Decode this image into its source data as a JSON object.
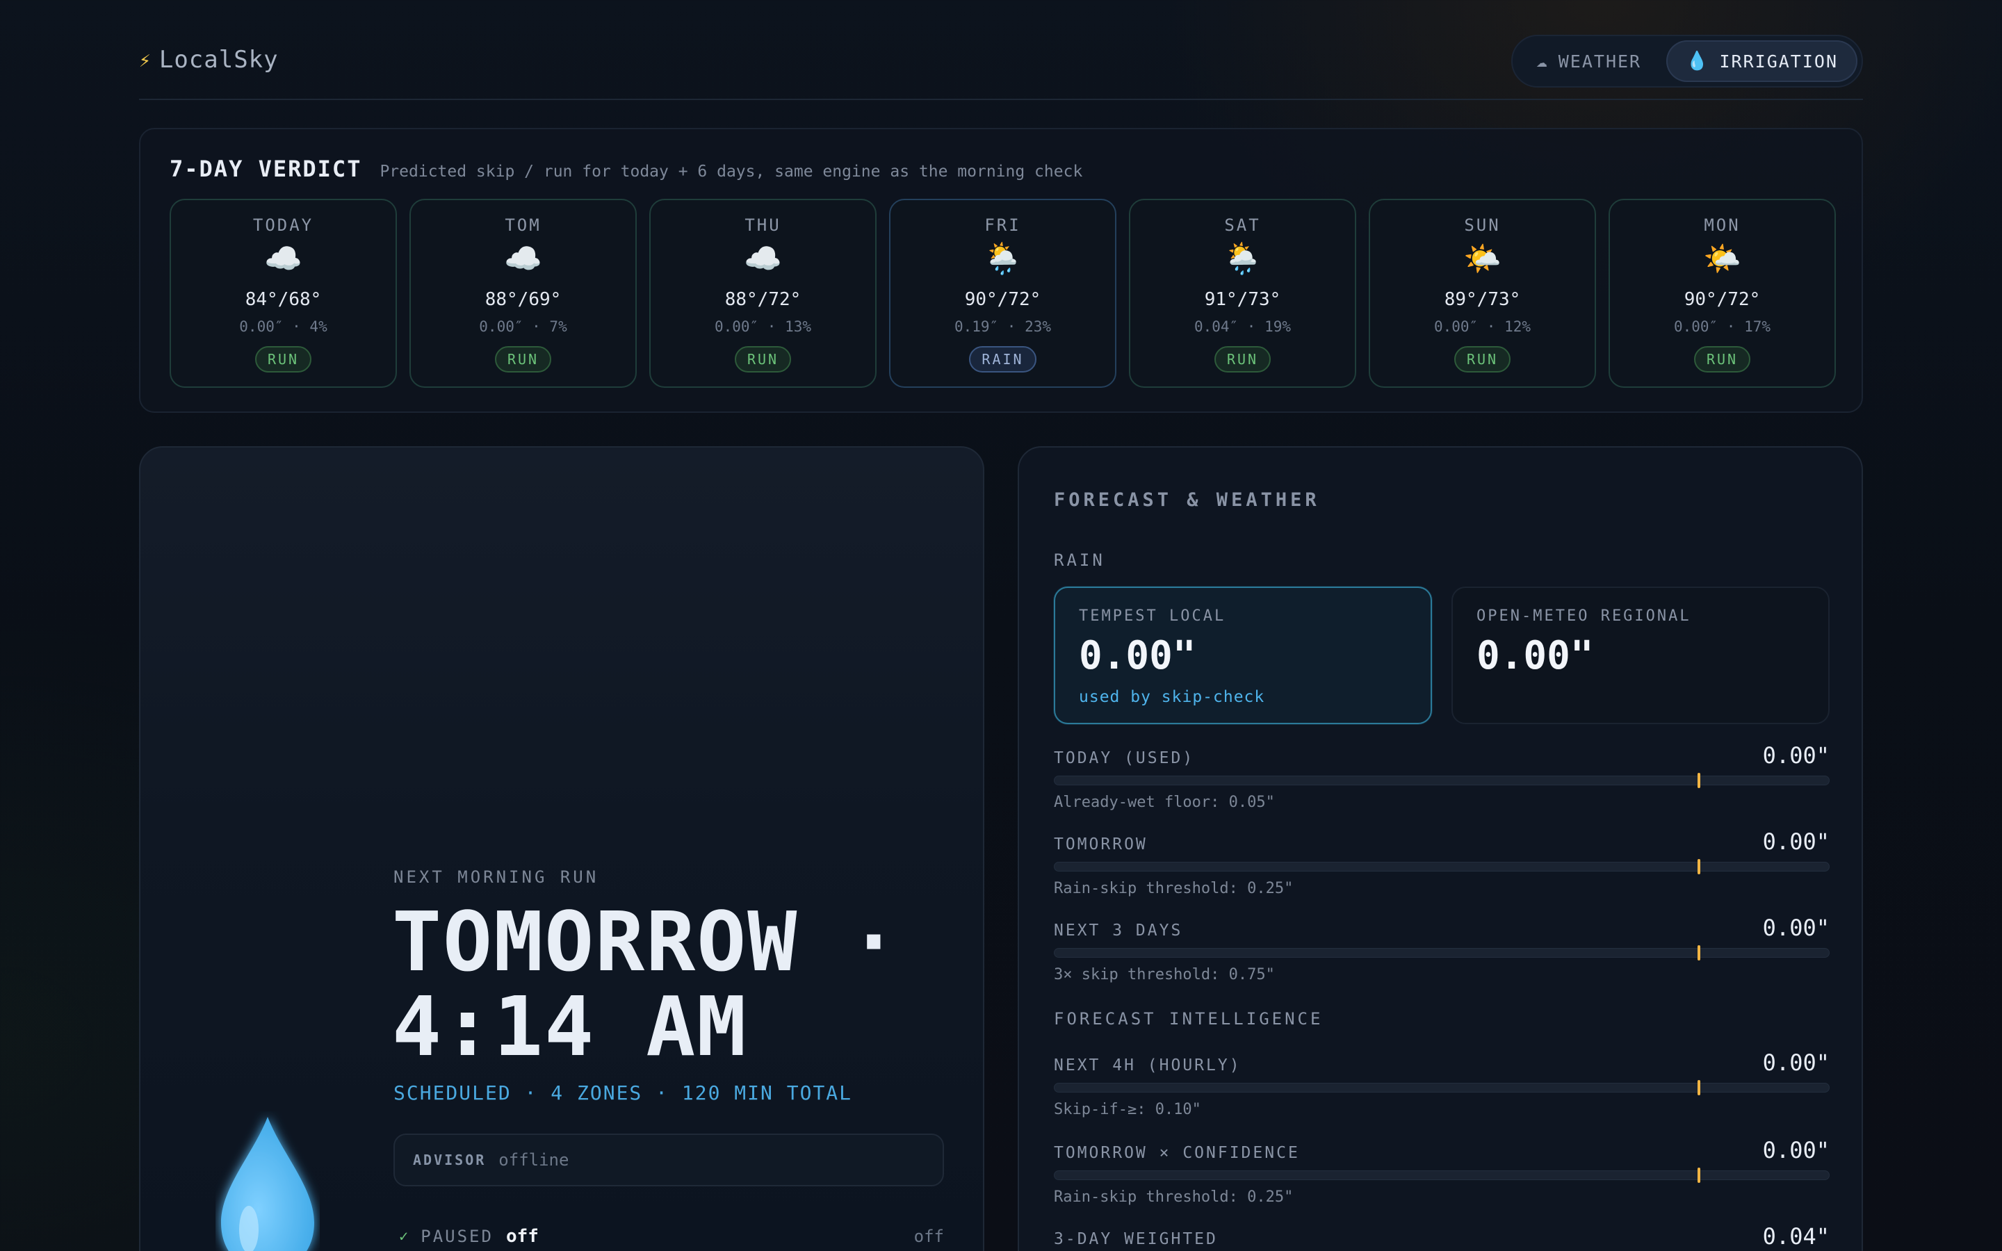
{
  "brand": {
    "icon": "lightning-icon",
    "name": "LocalSky"
  },
  "modes": [
    {
      "icon": "cloud-icon",
      "label": "WEATHER",
      "active": false
    },
    {
      "icon": "droplet-icon",
      "label": "IRRIGATION",
      "active": true
    }
  ],
  "verdict": {
    "title": "7-DAY VERDICT",
    "subtitle": "Predicted skip / run for today + 6 days, same engine as the morning check",
    "days": [
      {
        "label": "TODAY",
        "icon": "☁️",
        "temp": "84°/68°",
        "meta": "0.00″ · 4%",
        "status": "RUN"
      },
      {
        "label": "TOM",
        "icon": "☁️",
        "temp": "88°/69°",
        "meta": "0.00″ · 7%",
        "status": "RUN"
      },
      {
        "label": "THU",
        "icon": "☁️",
        "temp": "88°/72°",
        "meta": "0.00″ · 13%",
        "status": "RUN"
      },
      {
        "label": "FRI",
        "icon": "🌦️",
        "temp": "90°/72°",
        "meta": "0.19″ · 23%",
        "status": "RAIN"
      },
      {
        "label": "SAT",
        "icon": "🌦️",
        "temp": "91°/73°",
        "meta": "0.04″ · 19%",
        "status": "RUN"
      },
      {
        "label": "SUN",
        "icon": "🌤️",
        "temp": "89°/73°",
        "meta": "0.00″ · 12%",
        "status": "RUN"
      },
      {
        "label": "MON",
        "icon": "🌤️",
        "temp": "90°/72°",
        "meta": "0.00″ · 17%",
        "status": "RUN"
      }
    ]
  },
  "next_run": {
    "label": "NEXT MORNING RUN",
    "time": "TOMORROW · 4:14 AM",
    "schedule": "SCHEDULED · 4 ZONES · 120 MIN TOTAL",
    "advisor_label": "ADVISOR",
    "advisor_value": "offline",
    "paused_label": "PAUSED",
    "paused_value": "off",
    "paused_right": "off"
  },
  "forecast": {
    "title": "FORECAST & WEATHER",
    "rain_section": "RAIN",
    "local": {
      "label": "TEMPEST LOCAL",
      "value": "0.00\"",
      "note": "used by skip-check"
    },
    "regional": {
      "label": "OPEN-METEO REGIONAL",
      "value": "0.00\""
    },
    "intel_section": "FORECAST INTELLIGENCE",
    "metrics": [
      {
        "label": "TODAY (USED)",
        "value": "0.00\"",
        "note": "Already-wet floor: 0.05\"",
        "level": 0.83
      },
      {
        "label": "TOMORROW",
        "value": "0.00\"",
        "note": "Rain-skip threshold: 0.25\"",
        "level": 0.83
      },
      {
        "label": "NEXT 3 DAYS",
        "value": "0.00\"",
        "note": "3× skip threshold: 0.75\"",
        "level": 0.83
      },
      {
        "label": "NEXT 4H (HOURLY)",
        "value": "0.00\"",
        "note": "Skip-if-≥: 0.10\"",
        "level": 0.83
      },
      {
        "label": "TOMORROW × CONFIDENCE",
        "value": "0.00\"",
        "note": "Rain-skip threshold: 0.25\"",
        "level": 0.83
      },
      {
        "label": "3-DAY WEIGHTED",
        "value": "0.04\"",
        "note": "",
        "level": 0.83
      }
    ]
  },
  "colors": {
    "accent": "#4fb4ec",
    "run": "#6cc37a",
    "rain": "#9fb4d8",
    "marker": "#f2b544"
  }
}
